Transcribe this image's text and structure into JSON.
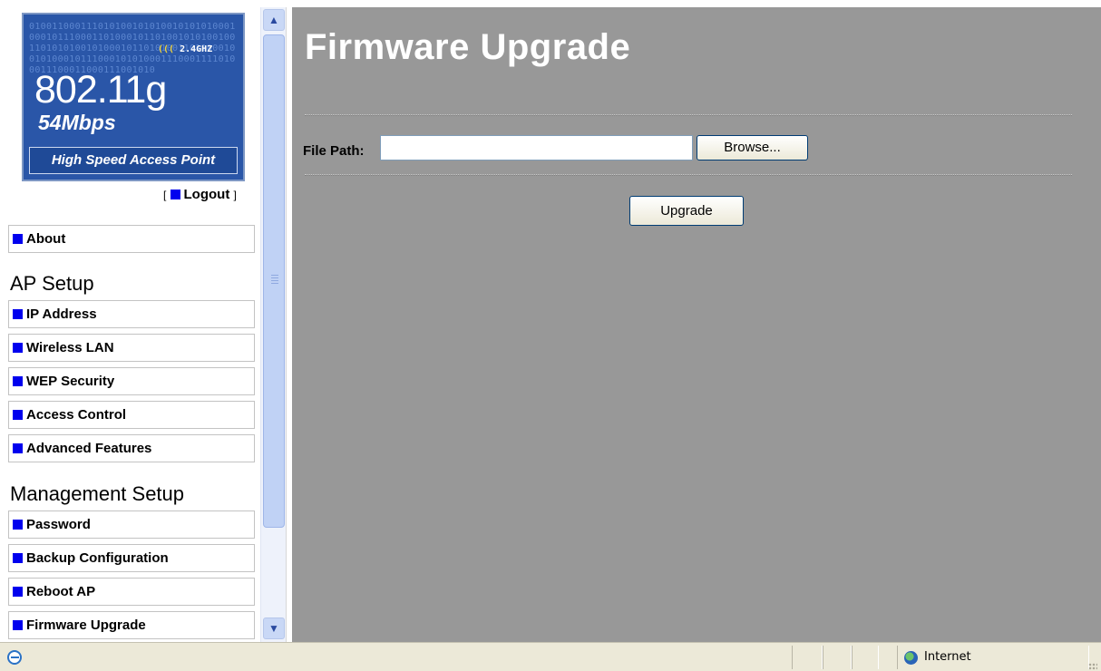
{
  "logo": {
    "binary_text": "0100110001110101001010100101010100010001011100011010001011010010101001001101010100101000101101010011011000100101000101110001010100011100011110100011100011000111001010",
    "freq": "2.4GHZ",
    "waves": "(((",
    "standard": "802.11g",
    "rate": "54Mbps",
    "tagline": "High Speed Access Point"
  },
  "logout": {
    "open": "[",
    "label": "Logout",
    "close": "]"
  },
  "nav": {
    "about": "About",
    "sections": [
      {
        "title": "AP Setup",
        "items": [
          "IP Address",
          "Wireless LAN",
          "WEP Security",
          "Access Control",
          "Advanced Features"
        ]
      },
      {
        "title": "Management Setup",
        "items": [
          "Password",
          "Backup Configuration",
          "Reboot AP",
          "Firmware Upgrade"
        ]
      }
    ]
  },
  "main": {
    "title": "Firmware Upgrade",
    "file_path_label": "File Path:",
    "file_path_value": "",
    "browse_label": "Browse...",
    "upgrade_label": "Upgrade"
  },
  "statusbar": {
    "zone": "Internet"
  },
  "colors": {
    "content_bg": "#989898",
    "logo_bg": "#2a56a8",
    "nav_bullet": "#0000ee",
    "title_text": "#ffffff",
    "scrollbar": "#c0d2f5"
  },
  "icons": [
    "ie-page-icon",
    "internet-zone-globe-icon",
    "scroll-up-icon",
    "scroll-down-icon"
  ]
}
